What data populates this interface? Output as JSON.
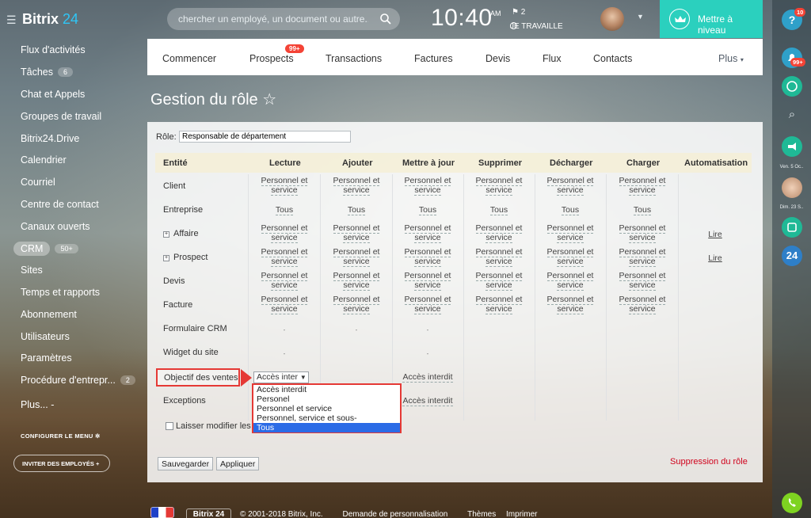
{
  "app": {
    "brand": "Bitrix",
    "brand_num": "24"
  },
  "header": {
    "search_placeholder": "chercher un employé, un document ou autre...",
    "time": "10:40",
    "ampm": "AM",
    "flag_count": "2",
    "work_status": "JE TRAVAILLE",
    "upgrade_label": "Mettre à niveau"
  },
  "sidebar": {
    "items": [
      {
        "label": "Flux d'activités"
      },
      {
        "label": "Tâches",
        "badge": "6"
      },
      {
        "label": "Chat et Appels"
      },
      {
        "label": "Groupes de travail"
      },
      {
        "label": "Bitrix24.Drive"
      },
      {
        "label": "Calendrier"
      },
      {
        "label": "Courriel"
      },
      {
        "label": "Centre de contact"
      },
      {
        "label": "Canaux ouverts"
      },
      {
        "label": "CRM",
        "badge": "50+"
      },
      {
        "label": "Sites"
      },
      {
        "label": "Temps et rapports"
      },
      {
        "label": "Abonnement"
      },
      {
        "label": "Utilisateurs"
      },
      {
        "label": "Paramètres"
      },
      {
        "label": "Procédure d'entrepr...",
        "badge": "2"
      },
      {
        "label": "Plus... -"
      }
    ],
    "configure": "CONFIGURER LE MENU",
    "invite": "INVITER DES EMPLOYÉS"
  },
  "crm_tabs": {
    "items": [
      "Commencer",
      "Prospects",
      "Transactions",
      "Factures",
      "Devis",
      "Flux",
      "Contacts"
    ],
    "prospects_badge": "99+",
    "more": "Plus"
  },
  "page": {
    "title": "Gestion du rôle",
    "star": "☆"
  },
  "role": {
    "label": "Rôle:",
    "value": "Responsable de département"
  },
  "table": {
    "headers": [
      "Entité",
      "Lecture",
      "Ajouter",
      "Mettre à jour",
      "Supprimer",
      "Décharger",
      "Charger",
      "Automatisation"
    ],
    "rows": [
      {
        "entity": "Client",
        "expand": false,
        "cells": [
          "Personnel et service",
          "Personnel et service",
          "Personnel et service",
          "Personnel et service",
          "Personnel et service",
          "Personnel et service"
        ],
        "auto": ""
      },
      {
        "entity": "Entreprise",
        "expand": false,
        "cells": [
          "Tous",
          "Tous",
          "Tous",
          "Tous",
          "Tous",
          "Tous"
        ],
        "auto": ""
      },
      {
        "entity": "Affaire",
        "expand": true,
        "cells": [
          "Personnel et service",
          "Personnel et service",
          "Personnel et service",
          "Personnel et service",
          "Personnel et service",
          "Personnel et service"
        ],
        "auto": "Lire"
      },
      {
        "entity": "Prospect",
        "expand": true,
        "cells": [
          "Personnel et service",
          "Personnel et service",
          "Personnel et service",
          "Personnel et service",
          "Personnel et service",
          "Personnel et service"
        ],
        "auto": "Lire"
      },
      {
        "entity": "Devis",
        "expand": false,
        "cells": [
          "Personnel et service",
          "Personnel et service",
          "Personnel et service",
          "Personnel et service",
          "Personnel et service",
          "Personnel et service"
        ],
        "auto": ""
      },
      {
        "entity": "Facture",
        "expand": false,
        "cells": [
          "Personnel et service",
          "Personnel et service",
          "Personnel et service",
          "Personnel et service",
          "Personnel et service",
          "Personnel et service"
        ],
        "auto": ""
      },
      {
        "entity": "Formulaire CRM",
        "expand": false,
        "cells": [
          "-",
          "-",
          "-",
          "",
          "",
          ""
        ],
        "auto": ""
      },
      {
        "entity": "Widget du site",
        "expand": false,
        "cells": [
          "-",
          "",
          "-",
          "",
          "",
          ""
        ],
        "auto": ""
      },
      {
        "entity": "Objectif des ventes",
        "expand": false,
        "cells": [
          "",
          "",
          "Accès interdit",
          "",
          "",
          ""
        ],
        "auto": ""
      },
      {
        "entity": "Exceptions",
        "expand": false,
        "cells": [
          "",
          "",
          "Accès interdit",
          "",
          "",
          ""
        ],
        "auto": ""
      }
    ]
  },
  "dropdown": {
    "selected": "Accès inter",
    "options": [
      "Accès interdit",
      "Personel",
      "Personnel et service",
      "Personnel, service et sous-départements",
      "Tous"
    ],
    "highlighted": "Tous"
  },
  "allow_modify_label": "Laisser modifier les",
  "buttons": {
    "save": "Sauvegarder",
    "apply": "Appliquer",
    "delete_role": "Suppression du rôle"
  },
  "footer": {
    "lang_brand": "Bitrix 24",
    "copyright": "© 2001-2018 Bitrix, Inc.",
    "customize": "Demande de personnalisation",
    "themes": "Thèmes",
    "print": "Imprimer"
  },
  "rail": {
    "help_badge": "10",
    "notif_badge": "99+",
    "date1": "Ven. 5 Oc..",
    "date2": "Dim. 23 S..",
    "b24": "24"
  },
  "colors": {
    "accent": "#2bd0be",
    "highlight": "#e53935",
    "selection": "#2b6be6",
    "link_blue": "#2fc6f6"
  }
}
